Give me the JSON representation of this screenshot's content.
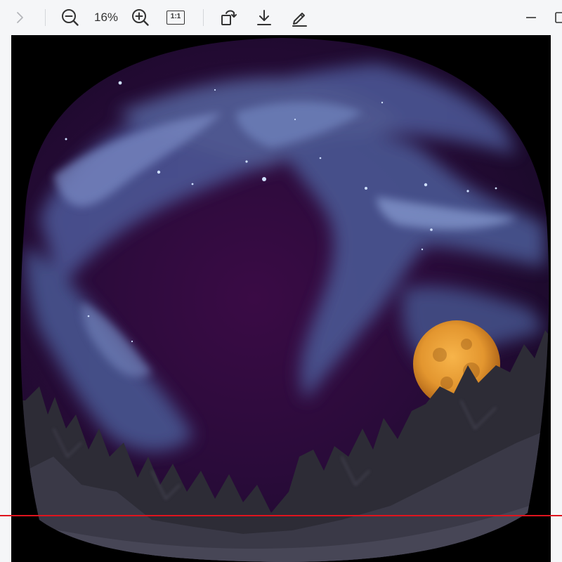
{
  "toolbar": {
    "zoom_level": "16%",
    "icons": {
      "next": "chevron-right-icon",
      "zoom_out": "zoom-out-icon",
      "zoom_in": "zoom-in-icon",
      "actual_size": "actual-size-icon",
      "rotate": "rotate-icon",
      "download": "download-icon",
      "edit": "edit-icon",
      "minimize": "minimize-icon",
      "maximize": "maximize-icon"
    },
    "actual_size_label": "1:1"
  },
  "image": {
    "description_icon": "fisheye-nebula-moon-landscape",
    "colors": {
      "background": "#000000",
      "sky": "#2e0a3a",
      "nebula": "#5b6fb0",
      "moon": "#e3962f",
      "mountains": "#2d2c36"
    }
  },
  "colors": {
    "toolbar_bg": "#f5f6f8",
    "icon": "#333333",
    "icon_disabled": "#b4b6ba",
    "guide_line": "#e0141e"
  }
}
